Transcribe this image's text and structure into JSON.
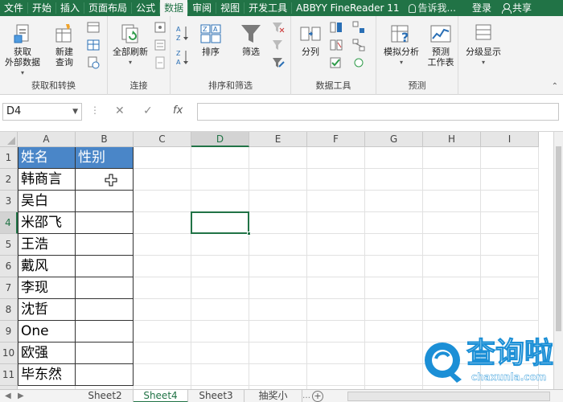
{
  "ribbon_tabs": [
    {
      "label": "文件"
    },
    {
      "label": "开始"
    },
    {
      "label": "插入"
    },
    {
      "label": "页面布局"
    },
    {
      "label": "公式"
    },
    {
      "label": "数据",
      "active": true
    },
    {
      "label": "审阅"
    },
    {
      "label": "视图"
    },
    {
      "label": "开发工具"
    },
    {
      "label": "ABBYY FineReader 11"
    }
  ],
  "tell_me": "告诉我...",
  "login": "登录",
  "share": "共享",
  "groups": {
    "get_transform": {
      "label": "获取和转换",
      "get_external": "获取\n外部数据",
      "new_query": "新建\n查询"
    },
    "connections": {
      "label": "连接",
      "refresh_all": "全部刷新"
    },
    "sort_filter": {
      "label": "排序和筛选",
      "sort": "排序",
      "filter": "筛选"
    },
    "data_tools": {
      "label": "数据工具",
      "split": "分列"
    },
    "forecast": {
      "label": "预测",
      "what_if": "模拟分析",
      "forecast_sheet": "预测\n工作表"
    },
    "outline": {
      "label": "",
      "outline_btn": "分级显示"
    }
  },
  "formula_bar": {
    "name_box": "D4",
    "fx": "fx",
    "formula": ""
  },
  "columns": [
    "A",
    "B",
    "C",
    "D",
    "E",
    "F",
    "G",
    "H",
    "I"
  ],
  "selected_column": "D",
  "rows": [
    "1",
    "2",
    "3",
    "4",
    "5",
    "6",
    "7",
    "8",
    "9",
    "10",
    "11"
  ],
  "selected_row": "4",
  "table": {
    "header": [
      "姓名",
      "性别"
    ],
    "names": [
      "韩商言",
      "吴白",
      "米邵飞",
      "王浩",
      "戴风",
      "李现",
      "沈哲",
      "One",
      "欧强",
      "毕东然"
    ]
  },
  "sheets": [
    {
      "label": "Sheet2"
    },
    {
      "label": "Sheet4",
      "active": true
    },
    {
      "label": "Sheet3"
    },
    {
      "label": "抽奖小"
    }
  ],
  "watermark": {
    "text": "查询啦",
    "url": "chaxunla.com"
  },
  "colors": {
    "accent": "#217346",
    "header_fill": "#4a86c8",
    "watermark": "#1b8fd6"
  }
}
